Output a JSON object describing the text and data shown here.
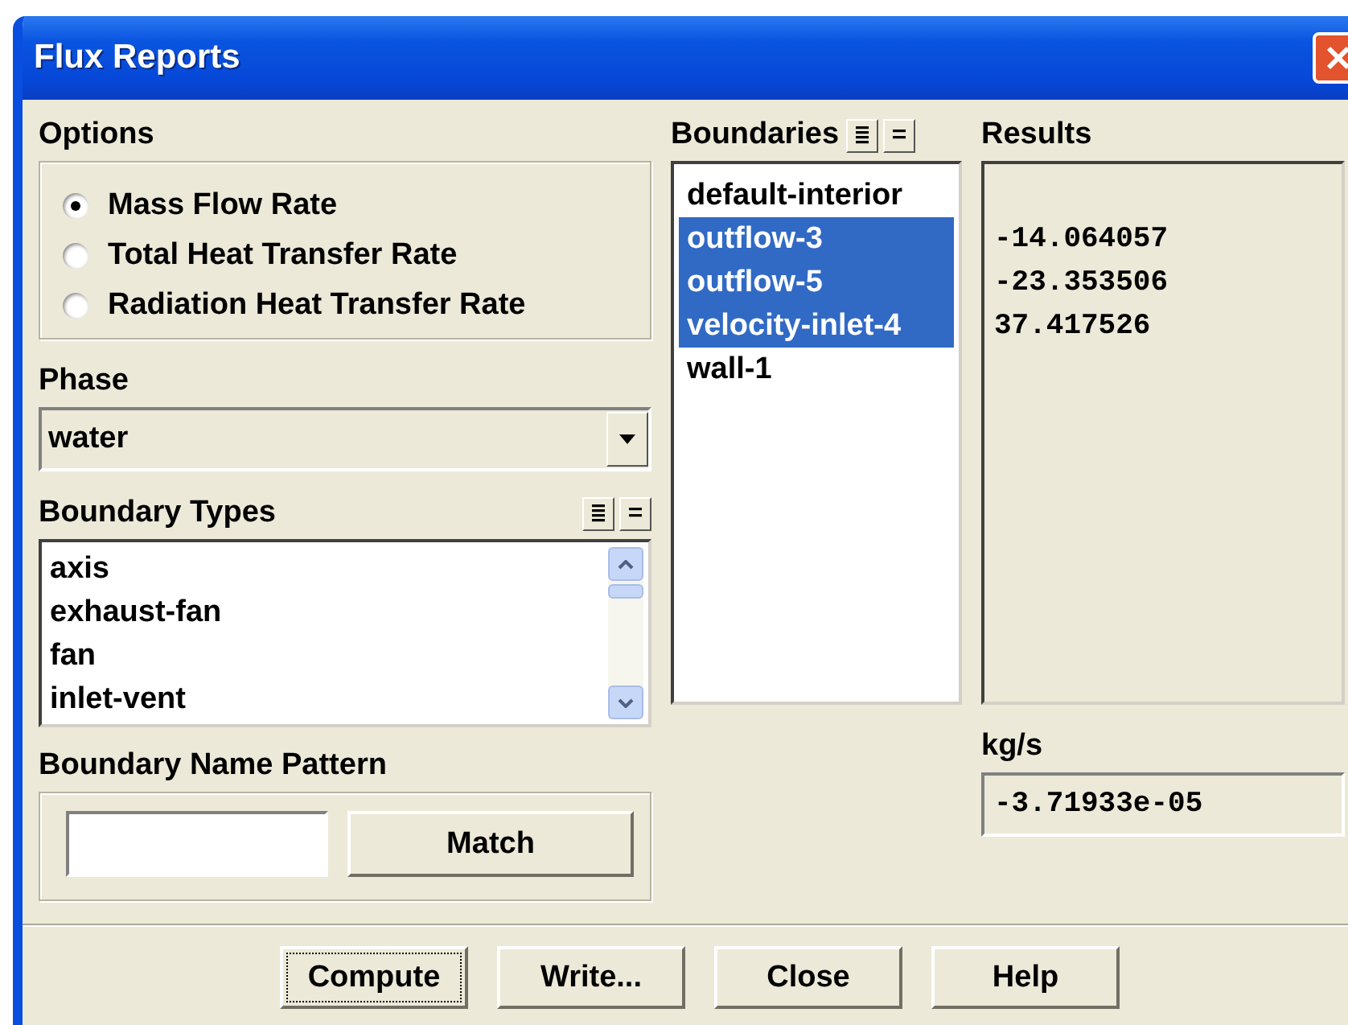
{
  "window": {
    "title": "Flux Reports"
  },
  "options": {
    "label": "Options",
    "items": [
      {
        "label": "Mass Flow Rate",
        "selected": true
      },
      {
        "label": "Total Heat Transfer Rate",
        "selected": false
      },
      {
        "label": "Radiation Heat Transfer Rate",
        "selected": false
      }
    ]
  },
  "phase": {
    "label": "Phase",
    "value": "water"
  },
  "boundary_types": {
    "label": "Boundary Types",
    "items": [
      {
        "label": "axis",
        "selected": false
      },
      {
        "label": "exhaust-fan",
        "selected": false
      },
      {
        "label": "fan",
        "selected": false
      },
      {
        "label": "inlet-vent",
        "selected": false
      }
    ]
  },
  "boundary_name_pattern": {
    "label": "Boundary Name Pattern",
    "button": "Match"
  },
  "boundaries": {
    "label": "Boundaries",
    "items": [
      {
        "label": "default-interior",
        "selected": false
      },
      {
        "label": "outflow-3",
        "selected": true
      },
      {
        "label": "outflow-5",
        "selected": true
      },
      {
        "label": "velocity-inlet-4",
        "selected": true
      },
      {
        "label": "wall-1",
        "selected": false
      }
    ]
  },
  "results": {
    "label": "Results",
    "values": [
      "-14.064057",
      "-23.353506",
      "37.417526"
    ]
  },
  "total": {
    "unit": "kg/s",
    "value": "-3.71933e-05"
  },
  "buttons": [
    {
      "label": "Compute",
      "focused": true
    },
    {
      "label": "Write...",
      "focused": false
    },
    {
      "label": "Close",
      "focused": false
    },
    {
      "label": "Help",
      "focused": false
    }
  ]
}
